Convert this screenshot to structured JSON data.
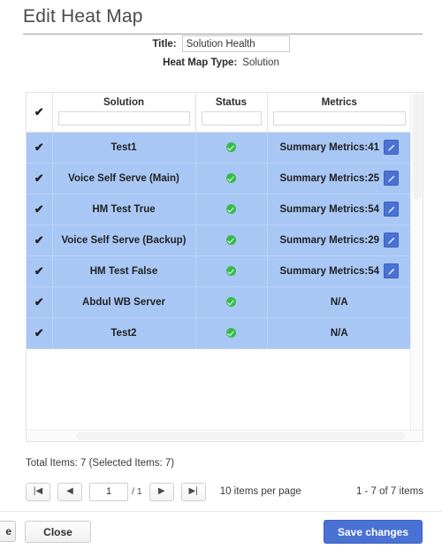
{
  "dialog": {
    "title": "Edit Heat Map"
  },
  "form": {
    "title_label": "Title:",
    "title_value": "Solution Health",
    "title_placeholder": "",
    "heatmap_type_label": "Heat Map Type:",
    "heatmap_type_value": "Solution"
  },
  "grid": {
    "select_all_icon": "check-icon",
    "columns": [
      {
        "key": "check",
        "label": "",
        "filter": "",
        "filter_placeholder": ""
      },
      {
        "key": "solution",
        "label": "Solution",
        "filter": "",
        "filter_placeholder": ""
      },
      {
        "key": "status",
        "label": "Status",
        "filter": "",
        "filter_placeholder": ""
      },
      {
        "key": "metrics",
        "label": "Metrics",
        "filter": "",
        "filter_placeholder": ""
      }
    ],
    "rows": [
      {
        "selected": true,
        "solution": "Test1",
        "status": "ok",
        "metrics": "Summary Metrics:41",
        "has_edit": true
      },
      {
        "selected": true,
        "solution": "Voice Self Serve (Main)",
        "status": "ok",
        "metrics": "Summary Metrics:25",
        "has_edit": true
      },
      {
        "selected": true,
        "solution": "HM Test True",
        "status": "ok",
        "metrics": "Summary Metrics:54",
        "has_edit": true
      },
      {
        "selected": true,
        "solution": "Voice Self Serve (Backup)",
        "status": "ok",
        "metrics": "Summary Metrics:29",
        "has_edit": true
      },
      {
        "selected": true,
        "solution": "HM Test False",
        "status": "ok",
        "metrics": "Summary Metrics:54",
        "has_edit": true
      },
      {
        "selected": true,
        "solution": "Abdul WB Server",
        "status": "ok",
        "metrics": "N/A",
        "has_edit": false
      },
      {
        "selected": true,
        "solution": "Test2",
        "status": "ok",
        "metrics": "N/A",
        "has_edit": false
      }
    ]
  },
  "footer": {
    "total_items": "Total Items: 7 (Selected Items: 7)",
    "pager": {
      "first_label": "|◀",
      "prev_label": "◀",
      "page_value": "1",
      "page_placeholder": "",
      "of_label": "/ 1",
      "next_label": "▶",
      "last_label": "▶|",
      "per_page": "10 items per page",
      "range": "1 - 7 of 7 items"
    }
  },
  "actions": {
    "offscreen_label": "e",
    "close_label": "Close",
    "save_label": "Save changes"
  },
  "colors": {
    "accent_blue": "#4a72d4",
    "row_selected": "#a9c7f5",
    "status_green": "#35bb4a"
  }
}
